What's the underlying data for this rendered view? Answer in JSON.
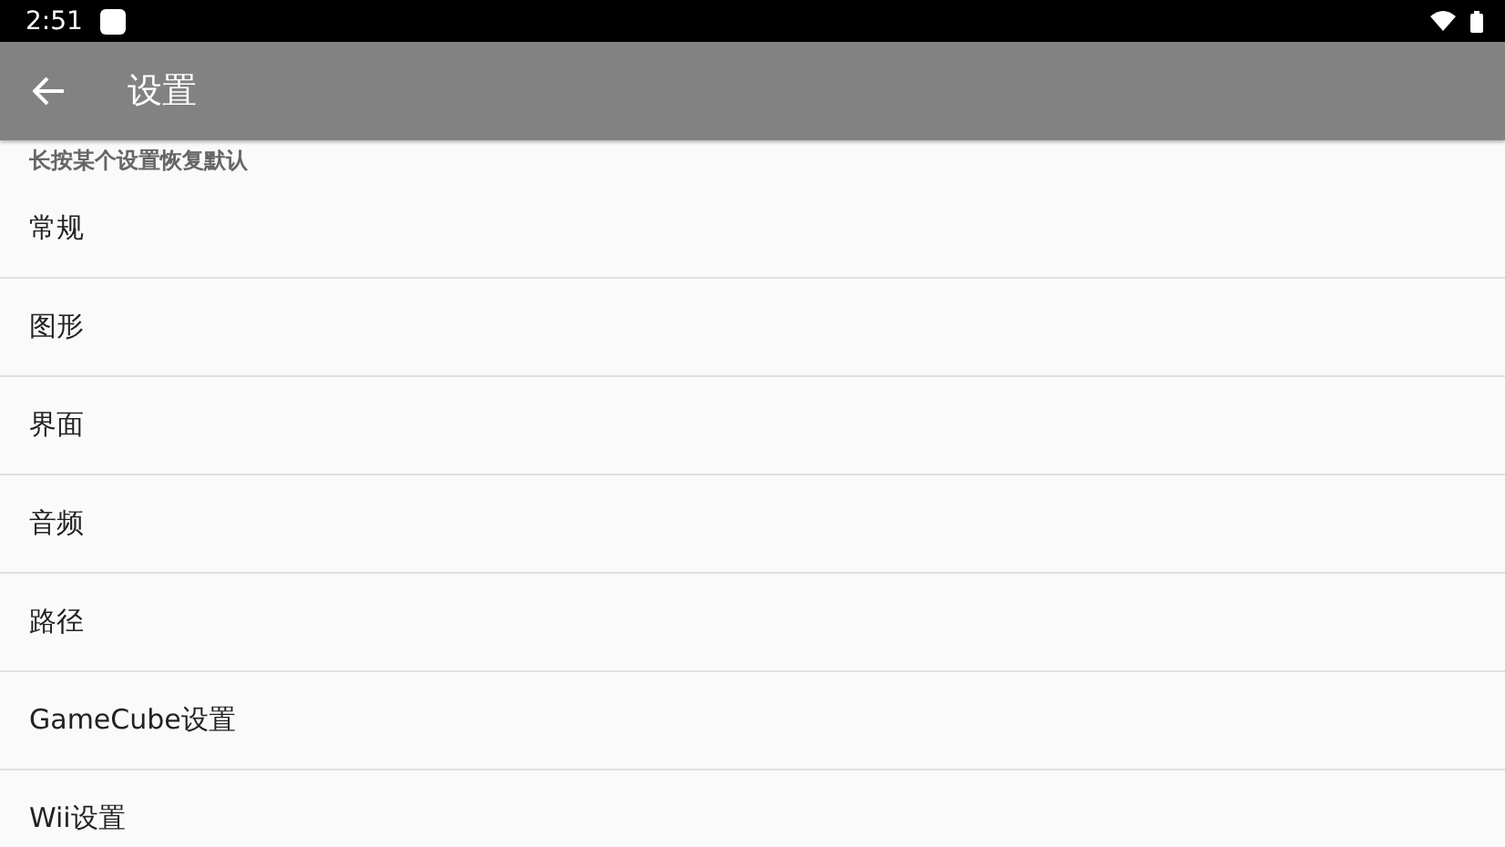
{
  "status_bar": {
    "time": "2:51"
  },
  "toolbar": {
    "title": "设置"
  },
  "hint": "长按某个设置恢复默认",
  "items": [
    {
      "label": "常规"
    },
    {
      "label": "图形"
    },
    {
      "label": "界面"
    },
    {
      "label": "音频"
    },
    {
      "label": "路径"
    },
    {
      "label": "GameCube设置"
    },
    {
      "label": "Wii设置"
    }
  ]
}
